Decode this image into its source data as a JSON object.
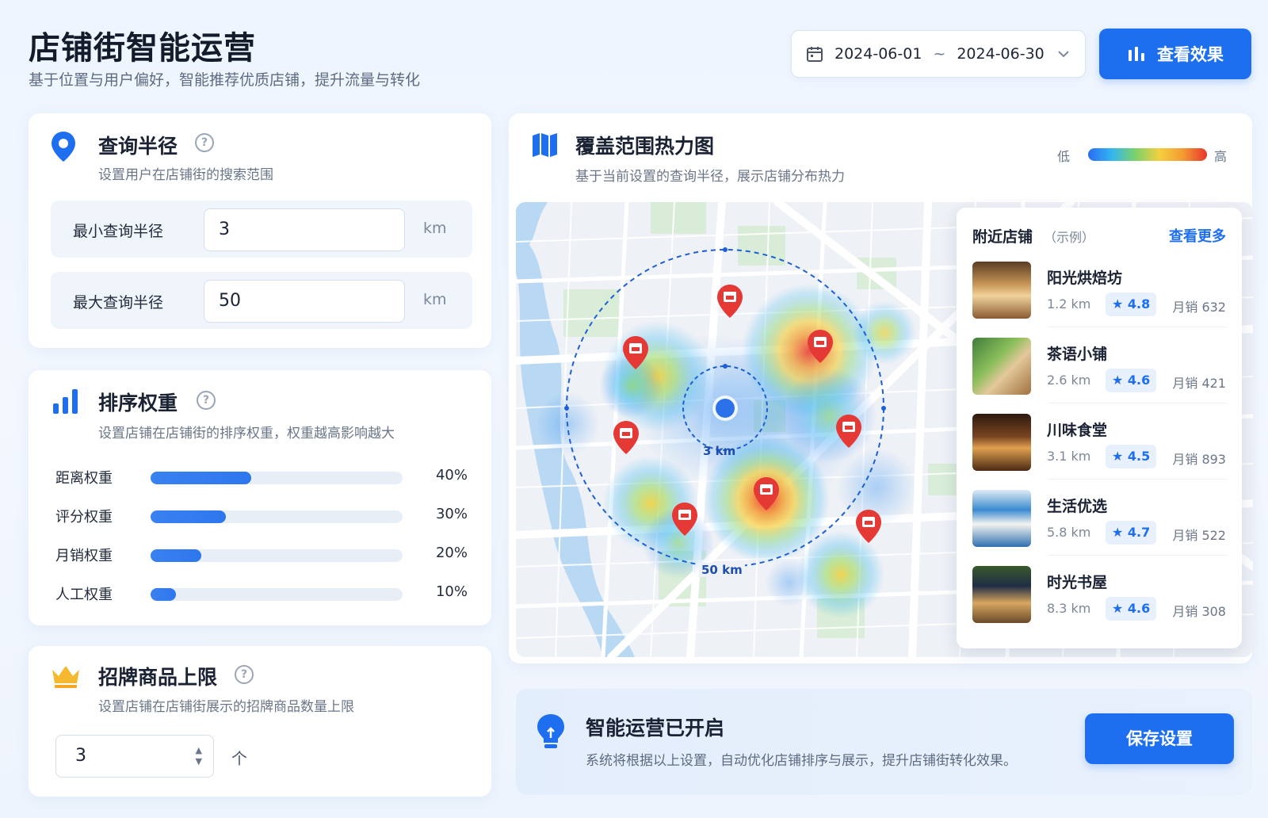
{
  "header": {
    "title": "店铺街智能运营",
    "subtitle": "基于位置与用户偏好，智能推荐优质店铺，提升流量与转化",
    "date_start": "2024-06-01",
    "date_sep": "~",
    "date_end": "2024-06-30",
    "view_effect": "查看效果"
  },
  "radius": {
    "title": "查询半径",
    "help": "?",
    "subtitle": "设置用户在店铺街的搜索范围",
    "min_label": "最小查询半径",
    "min_value": "3",
    "max_label": "最大查询半径",
    "max_value": "50",
    "unit": "km"
  },
  "weights": {
    "title": "排序权重",
    "help": "?",
    "subtitle": "设置店铺在店铺街的排序权重，权重越高影响越大",
    "items": [
      {
        "label": "距离权重",
        "percent": "40%",
        "value": 0.4
      },
      {
        "label": "评分权重",
        "percent": "30%",
        "value": 0.3
      },
      {
        "label": "月销权重",
        "percent": "20%",
        "value": 0.2
      },
      {
        "label": "人工权重",
        "percent": "10%",
        "value": 0.1
      }
    ]
  },
  "signature": {
    "title": "招牌商品上限",
    "help": "?",
    "subtitle": "设置店铺在店铺街展示的招牌商品数量上限",
    "value": "3",
    "unit": "个"
  },
  "heatmap": {
    "title": "覆盖范围热力图",
    "subtitle": "基于当前设置的查询半径，展示店铺分布热力",
    "legend_low": "低",
    "legend_high": "高",
    "inner_label": "3 km",
    "outer_label": "50 km"
  },
  "nearby": {
    "title": "附近店铺",
    "note": "（示例）",
    "more": "查看更多",
    "shops": [
      {
        "name": "阳光烘焙坊",
        "distance": "1.2 km",
        "rating": "4.8",
        "sales": "月销 632"
      },
      {
        "name": "茶语小铺",
        "distance": "2.6 km",
        "rating": "4.6",
        "sales": "月销 421"
      },
      {
        "name": "川味食堂",
        "distance": "3.1 km",
        "rating": "4.5",
        "sales": "月销 893"
      },
      {
        "name": "生活优选",
        "distance": "5.8 km",
        "rating": "4.7",
        "sales": "月销 522"
      },
      {
        "name": "时光书屋",
        "distance": "8.3 km",
        "rating": "4.6",
        "sales": "月销 308"
      }
    ]
  },
  "smart": {
    "title": "智能运营已开启",
    "desc": "系统将根据以上设置，自动优化店铺排序与展示，提升店铺街转化效果。",
    "save": "保存设置"
  },
  "colors": {
    "accent": "#1e6ff0",
    "pin": "#e53935"
  }
}
